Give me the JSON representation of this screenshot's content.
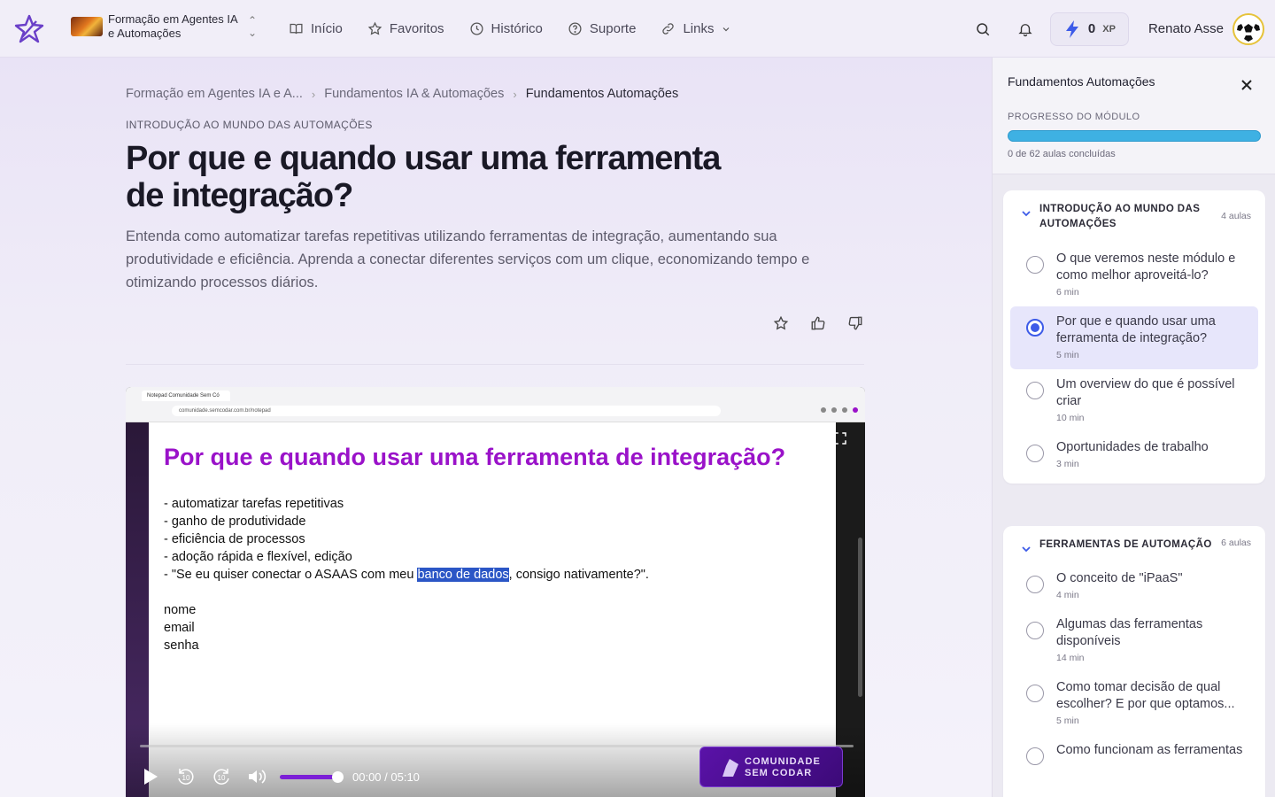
{
  "header": {
    "course_name": "Formação em Agentes IA e Automações",
    "nav": [
      {
        "label": "Início",
        "icon": "book-icon"
      },
      {
        "label": "Favoritos",
        "icon": "star-icon"
      },
      {
        "label": "Histórico",
        "icon": "clock-icon"
      },
      {
        "label": "Suporte",
        "icon": "help-circle-icon"
      },
      {
        "label": "Links",
        "icon": "link-icon"
      }
    ],
    "xp_value": "0",
    "xp_unit": "XP",
    "user_name": "Renato Asse"
  },
  "breadcrumb": [
    "Formação em Agentes IA e A...",
    "Fundamentos IA & Automações",
    "Fundamentos Automações"
  ],
  "lesson": {
    "kicker": "INTRODUÇÃO AO MUNDO DAS AUTOMAÇÕES",
    "title": "Por que e quando usar uma ferramenta de integração?",
    "description": "Entenda como automatizar tarefas repetitivas utilizando ferramentas de integração, aumentando sua produtividade e eficiência. Aprenda a conectar diferentes serviços com um clique, economizando tempo e otimizando processos diários."
  },
  "video": {
    "browser_tab": "Notepad Comunidade Sem Có",
    "browser_url": "comunidade.semcodar.com.br/notepad",
    "slide_title": "Por que e quando usar uma ferramenta de integração?",
    "slide_lines": [
      "- automatizar tarefas repetitivas",
      "- ganho de produtividade",
      "- eficiência de processos",
      "- adoção rápida e flexível, edição"
    ],
    "slide_quote_before": "- \"Se eu quiser conectar o ASAAS com meu ",
    "slide_quote_highlight": "banco de dados",
    "slide_quote_after": ", consigo nativamente?\".",
    "slide_words": [
      "nome",
      "email",
      "senha"
    ],
    "time": "00:00 / 05:10",
    "watermark_line1": "COMUNIDADE",
    "watermark_line2": "SEM CODAR"
  },
  "sidebar": {
    "title": "Fundamentos Automações",
    "progress_label": "PROGRESSO DO MÓDULO",
    "progress_text": "0 de 62 aulas concluídas",
    "modules": [
      {
        "title": "INTRODUÇÃO AO MUNDO DAS AUTOMAÇÕES",
        "count": "4 aulas",
        "lessons": [
          {
            "name": "O que veremos neste módulo e como melhor aproveitá-lo?",
            "duration": "6 min"
          },
          {
            "name": "Por que e quando usar uma ferramenta de integração?",
            "duration": "5 min"
          },
          {
            "name": "Um overview do que é possível criar",
            "duration": "10 min"
          },
          {
            "name": "Oportunidades de trabalho",
            "duration": "3 min"
          }
        ]
      },
      {
        "title": "FERRAMENTAS DE AUTOMAÇÃO",
        "count": "6 aulas",
        "lessons": [
          {
            "name": "O conceito de \"iPaaS\"",
            "duration": "4 min"
          },
          {
            "name": "Algumas das ferramentas disponíveis",
            "duration": "14 min"
          },
          {
            "name": "Como tomar decisão de qual escolher? E por que optamos...",
            "duration": "5 min"
          },
          {
            "name": "Como funcionam as ferramentas",
            "duration": ""
          }
        ]
      }
    ]
  },
  "colors": {
    "accent_purple": "#9a12c9",
    "progress_blue": "#3eb1e3",
    "active_radio": "#3d5be8",
    "xp_bolt": "#3d5be8"
  }
}
